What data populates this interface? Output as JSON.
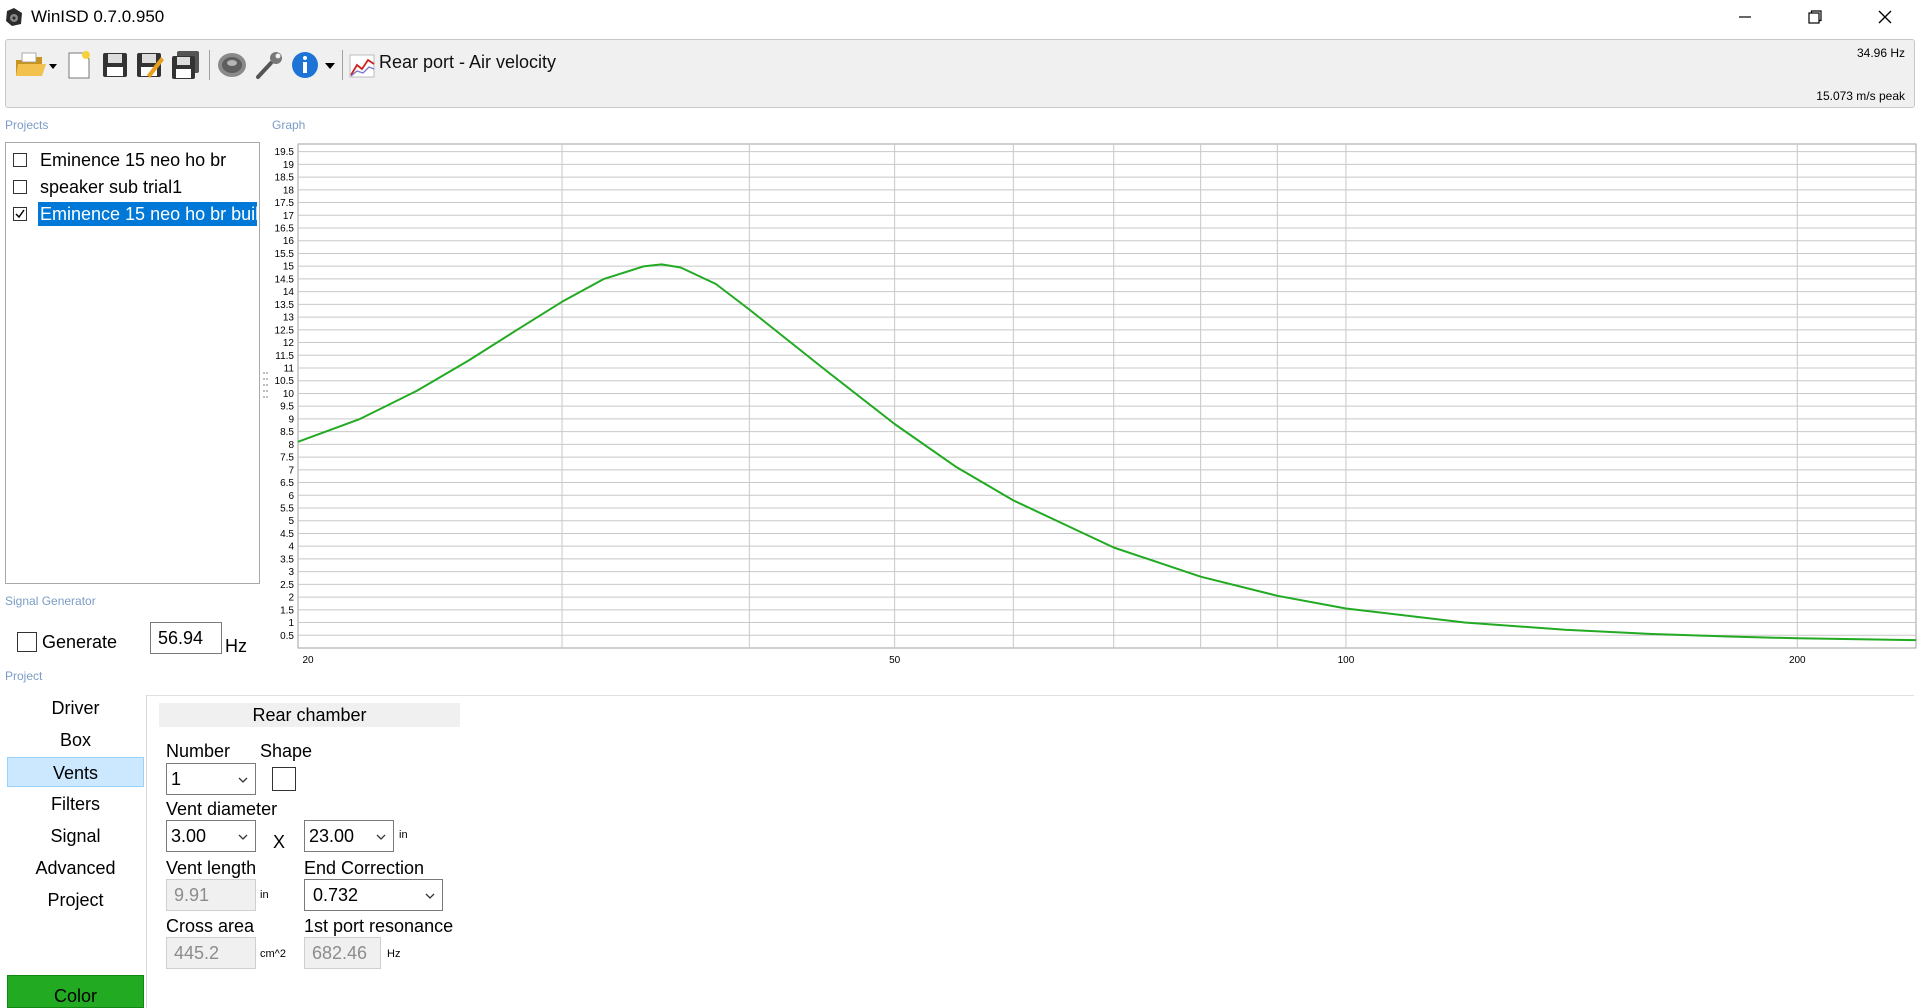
{
  "window": {
    "title": "WinISD 0.7.0.950",
    "icon": "winisd-speaker-icon"
  },
  "toolbar": {
    "buttons": [
      {
        "id": "open",
        "icon": "folder-open-icon"
      },
      {
        "id": "new",
        "icon": "new-document-icon"
      },
      {
        "id": "save",
        "icon": "floppy-save-icon"
      },
      {
        "id": "save-as",
        "icon": "floppy-edit-icon"
      },
      {
        "id": "save-all",
        "icon": "floppy-multi-icon"
      },
      {
        "id": "driver-editor",
        "icon": "speaker-driver-icon"
      },
      {
        "id": "tools",
        "icon": "wrench-icon"
      },
      {
        "id": "info",
        "icon": "info-icon"
      }
    ],
    "graph_type_label": "Rear port - Air velocity",
    "readout_freq": "34.96 Hz",
    "readout_value": "15.073 m/s peak"
  },
  "sections": {
    "projects": "Projects",
    "graph": "Graph",
    "signal_generator": "Signal Generator",
    "project": "Project"
  },
  "projects": [
    {
      "label": "Eminence 15 neo ho br",
      "checked": false,
      "selected": false
    },
    {
      "label": "speaker sub trial1",
      "checked": false,
      "selected": false
    },
    {
      "label": "Eminence 15 neo ho br buil",
      "checked": true,
      "selected": true
    }
  ],
  "signal_generator": {
    "generate_label": "Generate",
    "generate_checked": false,
    "frequency": "56.94",
    "unit": "Hz"
  },
  "nav": {
    "items": [
      "Driver",
      "Box",
      "Vents",
      "Filters",
      "Signal",
      "Advanced",
      "Project"
    ],
    "active": "Vents",
    "color_button": "Color"
  },
  "vents_panel": {
    "tab_title": "Rear chamber",
    "number_label": "Number",
    "number_value": "1",
    "shape_label": "Shape",
    "vent_diameter_label": "Vent diameter",
    "diameter_value": "3.00",
    "x_sign": "X",
    "second_dim_value": "23.00",
    "diameter_unit": "in",
    "vent_length_label": "Vent length",
    "vent_length_value": "9.91",
    "vent_length_unit": "in",
    "end_correction_label": "End Correction",
    "end_correction_value": "0.732",
    "cross_area_label": "Cross area",
    "cross_area_value": "445.2",
    "cross_area_unit": "cm^2",
    "resonance_label": "1st port resonance",
    "resonance_value": "682.46",
    "resonance_unit": "Hz"
  },
  "chart_data": {
    "type": "line",
    "xscale": "log",
    "xlim": [
      20,
      240
    ],
    "ylim": [
      0,
      19.8
    ],
    "x_ticks": [
      20,
      50,
      100,
      200
    ],
    "y_ticks": [
      "0.5",
      "1",
      "1.5",
      "2",
      "2.5",
      "3",
      "3.5",
      "4",
      "4.5",
      "5",
      "5.5",
      "6",
      "6.5",
      "7",
      "7.5",
      "8",
      "8.5",
      "9",
      "9.5",
      "10",
      "10.5",
      "11",
      "11.5",
      "12",
      "12.5",
      "13",
      "13.5",
      "14",
      "14.5",
      "15",
      "15.5",
      "16",
      "16.5",
      "17",
      "17.5",
      "18",
      "18.5",
      "19",
      "19.5"
    ],
    "grid": true,
    "series_color": "#22aa22",
    "series": [
      {
        "x": [
          20,
          22,
          24,
          26,
          28,
          30,
          32,
          34,
          34.96,
          36,
          38,
          40,
          45,
          50,
          55,
          60,
          70,
          80,
          90,
          100,
          120,
          140,
          160,
          180,
          200,
          220,
          240
        ],
        "y": [
          8.1,
          9.0,
          10.1,
          11.3,
          12.5,
          13.6,
          14.5,
          14.99,
          15.07,
          14.95,
          14.3,
          13.3,
          10.9,
          8.8,
          7.1,
          5.8,
          3.95,
          2.8,
          2.05,
          1.55,
          1.0,
          0.72,
          0.55,
          0.45,
          0.38,
          0.34,
          0.31
        ]
      }
    ]
  }
}
